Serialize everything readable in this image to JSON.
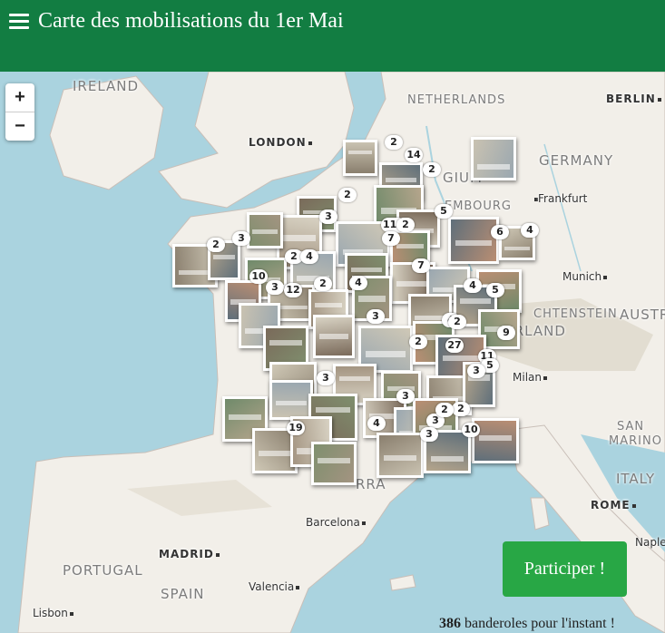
{
  "header": {
    "title": "Carte des mobilisations du 1er Mai"
  },
  "zoom": {
    "in": "+",
    "out": "−"
  },
  "labels": {
    "ireland": "IRELAND",
    "london": "LONDON",
    "netherlands": "NETHERLANDS",
    "berlin": "BERLIN",
    "germany": "GERMANY",
    "belgium": "GIUM",
    "frankfurt": "Frankfurt",
    "luxembourg": "EMBOURG",
    "munich": "Munich",
    "liechtenstein": "CHTENSTEIN",
    "austria": "AUSTR",
    "switzerland": "ZERLAND",
    "milan": "Milan",
    "san": "SAN",
    "marino": "MARINO",
    "italy": "ITALY",
    "rome": "ROME",
    "naples": "Naple",
    "barcelona": "Barcelona",
    "andorra": "RRA",
    "madrid": "MADRID",
    "portugal": "PORTUGAL",
    "spain": "SPAIN",
    "valencia": "Valencia",
    "lisbon": "Lisbon"
  },
  "clusters": [
    "2",
    "14",
    "2",
    "2",
    "3",
    "5",
    "110",
    "2",
    "6",
    "2",
    "3",
    "10",
    "2",
    "4",
    "7",
    "7",
    "4",
    "4",
    "3",
    "12",
    "2",
    "4",
    "5",
    "3",
    "4",
    "2",
    "9",
    "27",
    "3",
    "11",
    "5",
    "3",
    "2",
    "3",
    "3",
    "2",
    "4",
    "2",
    "19",
    "3",
    "10"
  ],
  "participate_label": "Participer !",
  "footer": {
    "count": "386",
    "suffix": " banderoles pour l'instant !"
  },
  "colors": {
    "header": "#127d42",
    "button": "#28a745",
    "sea": "#aad3df",
    "land": "#f2efe9"
  }
}
